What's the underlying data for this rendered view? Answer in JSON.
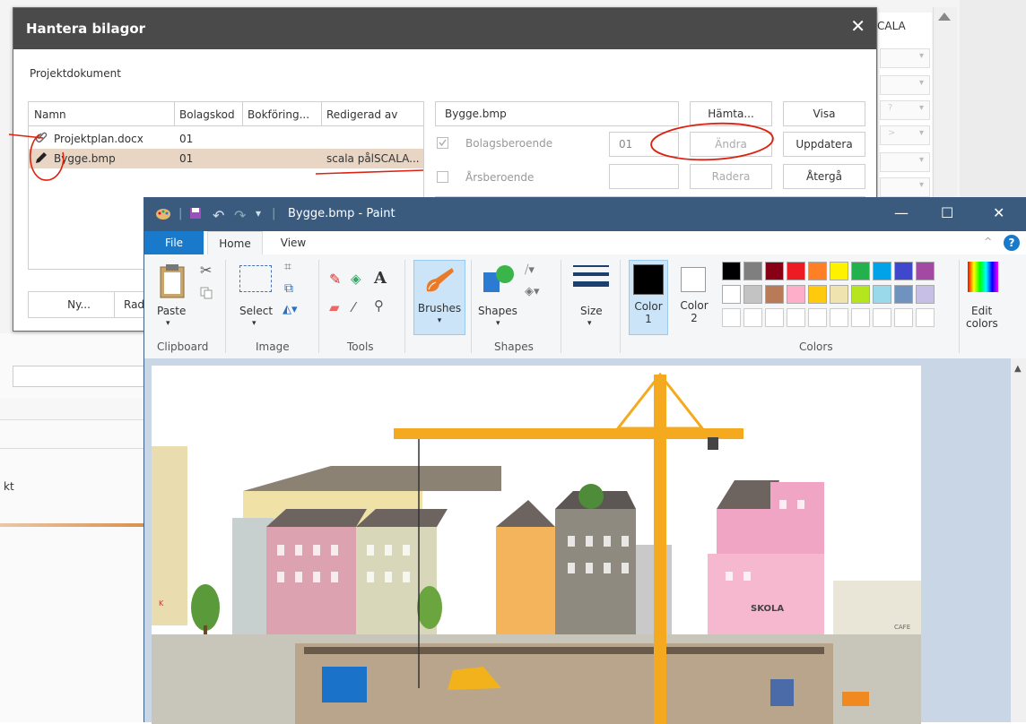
{
  "background": {
    "column_header": "CALA",
    "partial_text": "kt",
    "cell_values": [
      "",
      "",
      "?",
      ">",
      "",
      ""
    ]
  },
  "dialog": {
    "title": "Hantera bilagor",
    "close_glyph": "✕",
    "section_title": "Projektdokument",
    "grid": {
      "columns": [
        "Namn",
        "Bolagskod",
        "Bokföring...",
        "Redigerad av"
      ],
      "rows": [
        {
          "icon": "paperclip-icon",
          "name": "Projektplan.docx",
          "code": "01",
          "booking": "",
          "edited_by": ""
        },
        {
          "icon": "pencil-icon",
          "name": "Bygge.bmp",
          "code": "01",
          "booking": "",
          "edited_by": "scala pålSCALA..."
        }
      ]
    },
    "file_field": "Bygge.bmp",
    "buttons": {
      "fetch": "Hämta...",
      "show": "Visa",
      "change": "Ändra",
      "update": "Uppdatera",
      "delete": "Radera",
      "revert": "Återgå"
    },
    "company_dependent_label": "Bolagsberoende",
    "company_dependent_value": "01",
    "year_dependent_label": "Årsberoende",
    "year_dependent_value": "",
    "bottom_buttons": {
      "new": "Ny...",
      "delete_partial": "Rad"
    }
  },
  "paint": {
    "title": "Bygge.bmp - Paint",
    "window_controls": {
      "minimize": "—",
      "maximize": "☐",
      "close": "✕"
    },
    "tabs": [
      "File",
      "Home",
      "View"
    ],
    "active_tab": "Home",
    "groups": {
      "clipboard": {
        "label": "Clipboard",
        "paste": "Paste"
      },
      "image": {
        "label": "Image",
        "select": "Select"
      },
      "tools": {
        "label": "Tools"
      },
      "brushes": {
        "label": "Brushes"
      },
      "shapes": {
        "label": "Shapes",
        "shapes_btn": "Shapes"
      },
      "size": {
        "label": "Size"
      },
      "colors": {
        "label": "Colors",
        "color1": "Color\n1",
        "color1_line1": "Color",
        "color1_line2": "1",
        "color2_line1": "Color",
        "color2_line2": "2",
        "edit_line1": "Edit",
        "edit_line2": "colors"
      }
    },
    "palette_row1": [
      "#000000",
      "#7f7f7f",
      "#880015",
      "#ed1c24",
      "#ff7f27",
      "#fff200",
      "#22b14c",
      "#00a2e8",
      "#3f48cc",
      "#a349a4"
    ],
    "palette_row2": [
      "#ffffff",
      "#c3c3c3",
      "#b97a57",
      "#ffaec9",
      "#ffc90e",
      "#efe4b0",
      "#b5e61d",
      "#99d9ea",
      "#7092be",
      "#c8bfe7"
    ],
    "canvas_text": {
      "skola": "SKOLA",
      "cafe": "CAFE",
      "k": "K"
    }
  }
}
